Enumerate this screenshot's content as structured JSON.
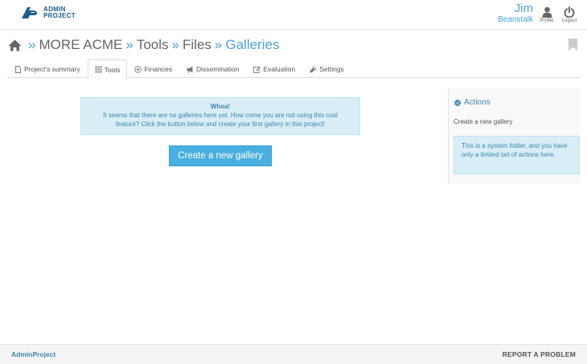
{
  "header": {
    "logo": {
      "line1": "ADMIN",
      "line2": "PROJECT",
      "mark": "AP"
    },
    "user": {
      "first_name": "Jim",
      "last_name": "Beanstalk"
    },
    "profile_label": "Profile",
    "logout_label": "Logout"
  },
  "breadcrumb": {
    "items": [
      "MORE ACME",
      "Tools",
      "Files",
      "Galleries"
    ],
    "separator": "»"
  },
  "tabs": [
    {
      "label": "Project's summary",
      "icon": "document-icon",
      "active": false
    },
    {
      "label": "Tools",
      "icon": "grid-icon",
      "active": true
    },
    {
      "label": "Finances",
      "icon": "coin-icon",
      "active": false
    },
    {
      "label": "Dissemination",
      "icon": "megaphone-icon",
      "active": false
    },
    {
      "label": "Evaluation",
      "icon": "edit-icon",
      "active": false
    },
    {
      "label": "Settings",
      "icon": "wrench-icon",
      "active": false
    }
  ],
  "alert": {
    "title": "Whoa!",
    "line1": "It seems that there are no galleries here yet. How come you are not using this cool",
    "line2": "feature? Click the button below and create your first gallery in this project!"
  },
  "create_button_label": "Create a new gallery",
  "sidebar": {
    "title": "Actions",
    "link": "Create a new gallery",
    "note": "This is a system folder, and you have only a limited set of actions here."
  },
  "footer": {
    "brand": "AdminProject",
    "report": "REPORT A PROBLEM"
  },
  "colors": {
    "accent": "#4aa3df",
    "button": "#49afe0",
    "info_bg": "#d9edf7",
    "info_text": "#3a87ad",
    "logo": "#1a5f8c"
  }
}
